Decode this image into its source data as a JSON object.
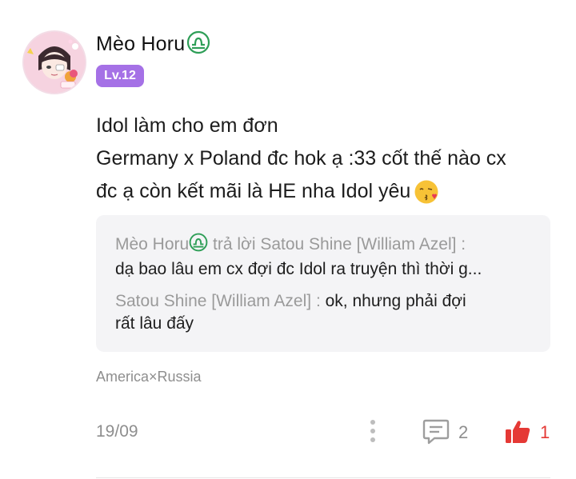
{
  "comment": {
    "author": {
      "name": "Mèo Horu",
      "zodiac_icon": "libra-icon",
      "level": "Lv.12",
      "avatar_icon": "anime-avatar"
    },
    "body_lines": [
      "Idol làm cho em đơn",
      "Germany x Poland đc hok ạ :33 cốt thế nào cx",
      "đc ạ còn kết mãi là HE nha Idol yêu"
    ],
    "body_emoji": "kissing-face-emoji",
    "replies": [
      {
        "author": "Mèo Horu",
        "connector": " trả lời ",
        "target": "Satou Shine [William Azel] :",
        "text": "dạ bao lâu em cx đợi đc Idol ra truyện thì thời g..."
      },
      {
        "author": "Satou Shine [William Azel] :",
        "text_line1": " ok, nhưng phải đợi",
        "text_line2": "rất lâu đấy"
      }
    ],
    "tag": "America×Russia",
    "date": "19/09",
    "comment_count": "2",
    "like_count": "1"
  },
  "colors": {
    "level_badge": "#a571e6",
    "zodiac": "#2e9e57",
    "like": "#e53935",
    "reply_bg": "#f4f4f6",
    "muted_text": "#9a9a9a"
  }
}
